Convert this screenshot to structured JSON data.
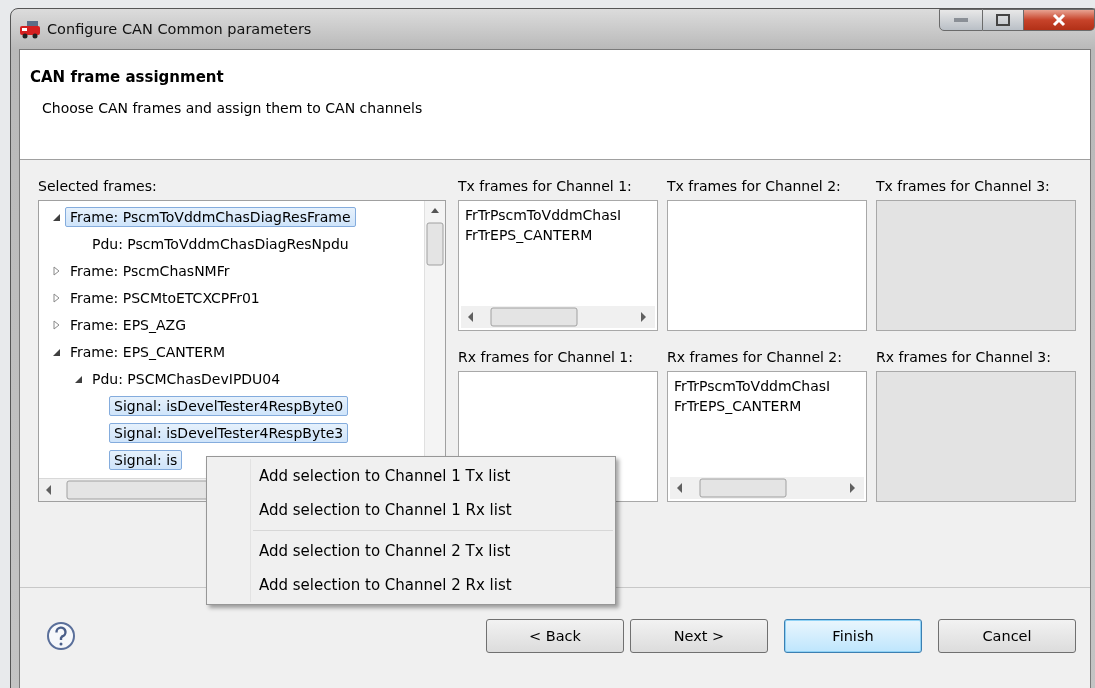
{
  "window": {
    "title": "Configure CAN Common parameters"
  },
  "header": {
    "title": "CAN frame assignment",
    "description": "Choose CAN frames and assign them to CAN channels"
  },
  "tree": {
    "label": "Selected frames:",
    "items": [
      {
        "label": "Frame: PscmToVddmChasDiagResFrame",
        "selected": true,
        "expanded": true,
        "children": [
          {
            "label": "Pdu: PscmToVddmChasDiagResNpdu",
            "selected": false
          }
        ]
      },
      {
        "label": "Frame: PscmChasNMFr",
        "selected": false,
        "expanded": false
      },
      {
        "label": "Frame: PSCMtoETCXCPFr01",
        "selected": false,
        "expanded": false
      },
      {
        "label": "Frame: EPS_AZG",
        "selected": false,
        "expanded": false
      },
      {
        "label": "Frame: EPS_CANTERM",
        "selected": false,
        "expanded": true,
        "children": [
          {
            "label": "Pdu: PSCMChasDevIPDU04",
            "selected": false,
            "expanded": true,
            "children": [
              {
                "label": "Signal: isDevelTester4RespByte0",
                "selected": true
              },
              {
                "label": "Signal: isDevelTester4RespByte3",
                "selected": true
              },
              {
                "label": "Signal: is",
                "selected": true
              }
            ]
          }
        ]
      }
    ]
  },
  "lists": [
    {
      "label": "Tx frames for Channel 1:",
      "enabled": true,
      "items": [
        "FrTrPscmToVddmChasI",
        "FrTrEPS_CANTERM"
      ]
    },
    {
      "label": "Tx frames for Channel 2:",
      "enabled": true
    },
    {
      "label": "Tx frames for Channel 3:",
      "enabled": false
    },
    {
      "label": "Rx frames for Channel 1:",
      "enabled": true
    },
    {
      "label": "Rx frames for Channel 2:",
      "enabled": true,
      "items": [
        "FrTrPscmToVddmChasI",
        "FrTrEPS_CANTERM"
      ]
    },
    {
      "label": "Rx frames for Channel 3:",
      "enabled": false
    }
  ],
  "context_menu": {
    "groups": [
      [
        "Add selection to Channel 1 Tx list",
        "Add selection to Channel 1 Rx list"
      ],
      [
        "Add selection to Channel 2 Tx list",
        "Add selection to Channel 2 Rx list"
      ]
    ]
  },
  "buttons": [
    {
      "label": "< Back",
      "default": false
    },
    {
      "label": "Next >",
      "default": false
    },
    {
      "label": "Finish",
      "default": true
    },
    {
      "label": "Cancel",
      "default": false
    }
  ]
}
